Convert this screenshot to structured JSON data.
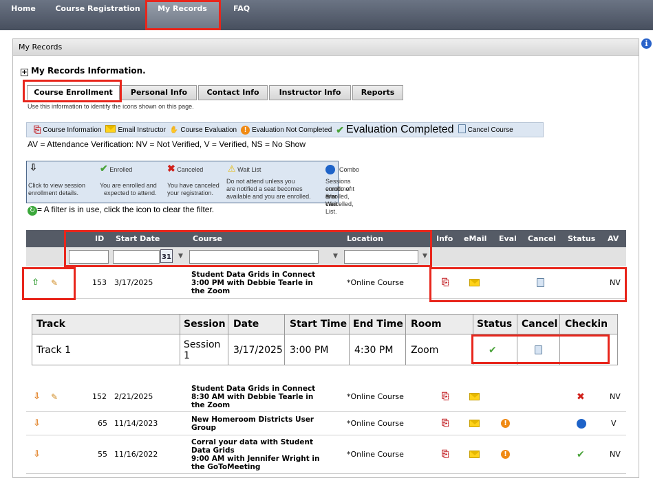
{
  "nav": {
    "items": [
      "Home",
      "Course Registration",
      "My Records",
      "FAQ"
    ],
    "active": "My Records"
  },
  "panel": {
    "title": "My Records"
  },
  "section_title": "My Records Information.",
  "tabs": [
    "Course Enrollment",
    "Personal Info",
    "Contact Info",
    "Instructor Info",
    "Reports"
  ],
  "intro_text": "Use this information to identify the icons shown on this page.",
  "legend": {
    "course_info": "Course Information",
    "email_instructor": "Email Instructor",
    "course_evaluation": "Course Evaluation",
    "eval_not_completed": "Evaluation Not Completed",
    "eval_completed": "Evaluation Completed",
    "cancel_course": "Cancel Course"
  },
  "av_line": "AV = Attendance Verification: NV = Not Verified, V = Verified, NS = No Show",
  "keybox": {
    "enrolled": "Enrolled",
    "canceled": "Canceled",
    "wait_list": "Wait List",
    "combo": "Combo",
    "click_desc_1": "Click to view session",
    "click_desc_2": "enrollment details.",
    "enrolled_desc_1": "You are enrolled and",
    "enrolled_desc_2": "expected to attend.",
    "canceled_desc_1": "You have canceled",
    "canceled_desc_2": "your registration.",
    "wait_desc_1": "Do not attend unless you",
    "wait_desc_2": "are notified a seat becomes",
    "wait_desc_3": "available and you are enrolled.",
    "combo_desc_1": "Sessions enrollment is a",
    "combo_desc_2": "combo of enrolled, cancelled,",
    "combo_desc_3": "&/or Wait List."
  },
  "filter_note": "= A filter is in use, click the icon to clear the filter.",
  "grid": {
    "headers": {
      "id": "ID",
      "start_date": "Start Date",
      "course": "Course",
      "location": "Location",
      "info": "Info",
      "email": "eMail",
      "eval": "Eval",
      "cancel": "Cancel",
      "status": "Status",
      "av": "AV"
    },
    "calendar_day": "31",
    "rows": [
      {
        "id": "153",
        "date": "3/17/2025",
        "course_1": "Student Data Grids in Connect",
        "course_2": "3:00 PM with Debbie Tearle in",
        "course_3": "the Zoom",
        "location": "*Online Course",
        "av": "NV"
      },
      {
        "id": "152",
        "date": "2/21/2025",
        "course_1": "Student Data Grids in Connect",
        "course_2": "8:30 AM with Debbie Tearle in",
        "course_3": "the Zoom",
        "location": "*Online Course",
        "av": "NV"
      },
      {
        "id": "65",
        "date": "11/14/2023",
        "course_1": "New Homeroom Districts User",
        "course_2": "Group",
        "location": "*Online Course",
        "av": "V"
      },
      {
        "id": "55",
        "date": "11/16/2022",
        "course_1": "Corral your data with Student",
        "course_2": "Data Grids",
        "course_3": "9:00 AM with Jennifer Wright in",
        "course_4": "the GoToMeeting",
        "location": "*Online Course",
        "av": "NV"
      }
    ]
  },
  "sessions": {
    "headers": {
      "track": "Track",
      "session": "Session",
      "date": "Date",
      "start": "Start Time",
      "end": "End Time",
      "room": "Room",
      "status": "Status",
      "cancel": "Cancel",
      "checkin": "Checkin"
    },
    "row": {
      "track": "Track 1",
      "session_1": "Session",
      "session_2": "1",
      "date": "3/17/2025",
      "start": "3:00 PM",
      "end": "4:30 PM",
      "room": "Zoom"
    }
  },
  "colors": {
    "highlight": "#e8261c",
    "nav": "#555b66",
    "legend_bg": "#dce6f2"
  }
}
